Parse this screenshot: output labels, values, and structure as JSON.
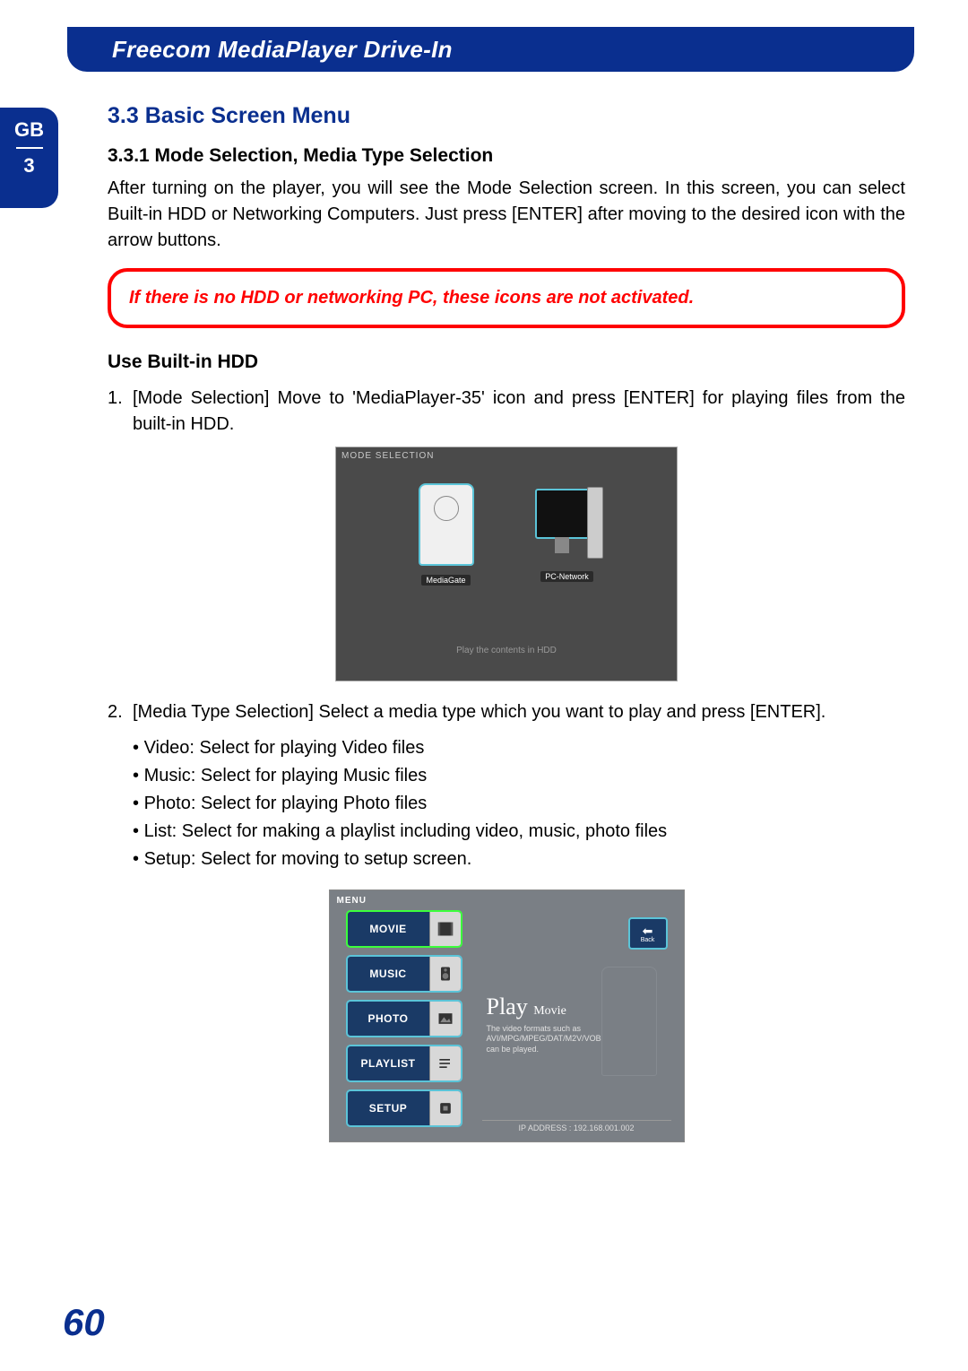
{
  "header": {
    "title": "Freecom MediaPlayer Drive-In"
  },
  "side_tab": {
    "lang": "GB",
    "chapter": "3"
  },
  "section": {
    "number_title": "3.3 Basic Screen Menu",
    "sub_number_title": "3.3.1 Mode Selection, Media Type Selection",
    "intro": "After turning on the player, you will see the Mode Selection screen. In this screen, you can select Built-in HDD or Networking Computers. Just press [ENTER] after moving to the desired icon with the arrow buttons."
  },
  "warning": "If there is no HDD or networking PC, these icons are not activated.",
  "use_hdd": {
    "heading": "Use Built-in HDD",
    "steps": [
      "[Mode Selection] Move to 'MediaPlayer-35' icon and press [ENTER] for playing files from the built-in HDD.",
      "[Media Type Selection] Select a media type which you want to play and press [ENTER]."
    ],
    "bullets": [
      "Video: Select for playing Video files",
      "Music: Select for playing Music files",
      "Photo: Select for playing Photo files",
      "List: Select for making a playlist including video, music, photo files",
      "Setup: Select for moving to setup screen."
    ]
  },
  "screen1": {
    "title": "MODE SELECTION",
    "left_label": "MediaGate",
    "right_label": "PC-Network",
    "footer": "Play the contents in HDD"
  },
  "screen2": {
    "menu_label": "MENU",
    "items": [
      "MOVIE",
      "MUSIC",
      "PHOTO",
      "PLAYLIST",
      "SETUP"
    ],
    "back": "Back",
    "play_big": "Play",
    "play_small": "Movie",
    "desc1": "The video formats such as",
    "desc2": "AVI/MPG/MPEG/DAT/M2V/VOB",
    "desc3": "can be played.",
    "ip": "IP ADDRESS : 192.168.001.002"
  },
  "page_number": "60"
}
